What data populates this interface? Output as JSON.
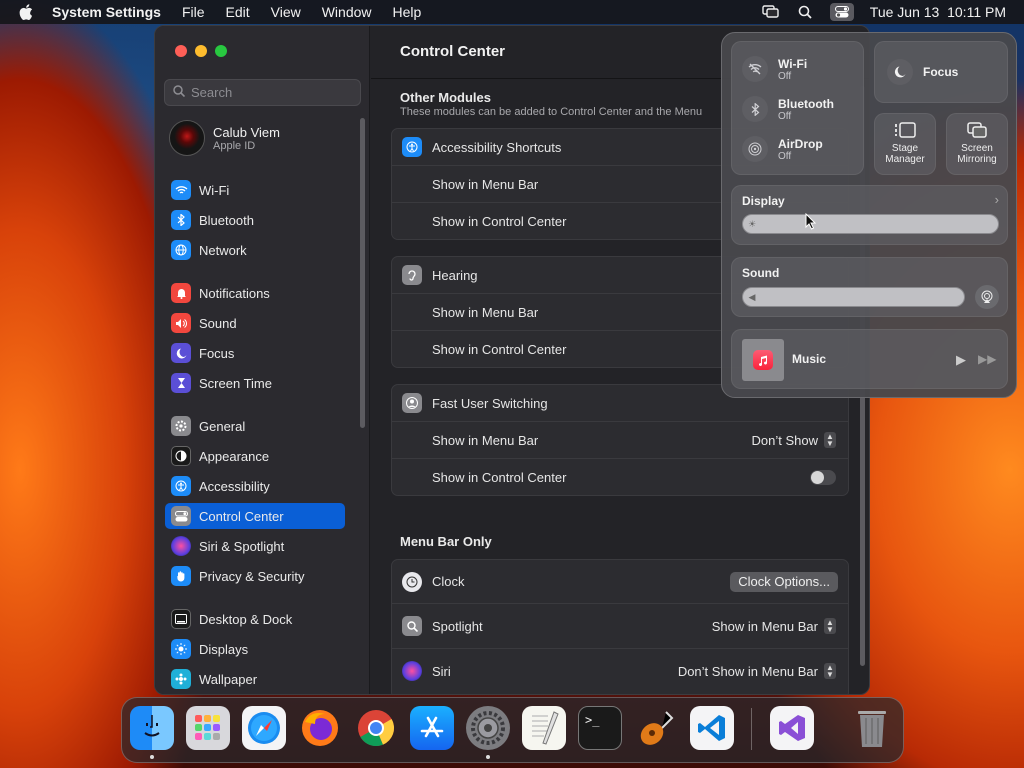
{
  "menubar": {
    "app_name": "System Settings",
    "items": [
      "File",
      "Edit",
      "View",
      "Window",
      "Help"
    ],
    "datetime": "Tue Jun 13  10:11 PM"
  },
  "window": {
    "search_placeholder": "Search",
    "profile": {
      "name": "Calub Viem",
      "subtitle": "Apple ID"
    },
    "sidebar": [
      {
        "label": "Wi-Fi",
        "icon": "wifi-icon",
        "color": "#1d8cf8"
      },
      {
        "label": "Bluetooth",
        "icon": "bluetooth-icon",
        "color": "#1d8cf8"
      },
      {
        "label": "Network",
        "icon": "globe-icon",
        "color": "#1d8cf8"
      },
      {
        "label": "Notifications",
        "icon": "bell-icon",
        "color": "#f2473e"
      },
      {
        "label": "Sound",
        "icon": "speaker-icon",
        "color": "#f2473e"
      },
      {
        "label": "Focus",
        "icon": "moon-icon",
        "color": "#5b4fd6"
      },
      {
        "label": "Screen Time",
        "icon": "hourglass-icon",
        "color": "#5b4fd6"
      },
      {
        "label": "General",
        "icon": "gear-icon",
        "color": "#8a8a8e"
      },
      {
        "label": "Appearance",
        "icon": "appearance-icon",
        "color": "#1a1a1a"
      },
      {
        "label": "Accessibility",
        "icon": "accessibility-icon",
        "color": "#1d8cf8"
      },
      {
        "label": "Control Center",
        "icon": "control-center-icon",
        "color": "#8a8a8e"
      },
      {
        "label": "Siri & Spotlight",
        "icon": "siri-icon",
        "color": "#9b3fd1"
      },
      {
        "label": "Privacy & Security",
        "icon": "hand-icon",
        "color": "#1d8cf8"
      },
      {
        "label": "Desktop & Dock",
        "icon": "dock-icon",
        "color": "#1a1a1a"
      },
      {
        "label": "Displays",
        "icon": "sun-icon",
        "color": "#1d8cf8"
      },
      {
        "label": "Wallpaper",
        "icon": "wallpaper-icon",
        "color": "#1fb0d8"
      }
    ],
    "selected_sidebar": "Control Center",
    "main": {
      "title": "Control Center",
      "other_modules_title": "Other Modules",
      "other_modules_sub": "These modules can be added to Control Center and the Menu",
      "accessibility": {
        "title": "Accessibility Shortcuts",
        "row1": "Show in Menu Bar",
        "row2": "Show in Control Center"
      },
      "hearing": {
        "title": "Hearing",
        "row1": "Show in Menu Bar",
        "row2": "Show in Control Center"
      },
      "fus": {
        "title": "Fast User Switching",
        "row1": "Show in Menu Bar",
        "row1_value": "Don’t Show",
        "row2": "Show in Control Center"
      },
      "menu_bar_only_title": "Menu Bar Only",
      "clock": {
        "title": "Clock",
        "button": "Clock Options..."
      },
      "spotlight": {
        "title": "Spotlight",
        "value": "Show in Menu Bar"
      },
      "siri": {
        "title": "Siri",
        "value": "Don’t Show in Menu Bar"
      }
    }
  },
  "control_center": {
    "wifi": {
      "title": "Wi-Fi",
      "status": "Off"
    },
    "bluetooth": {
      "title": "Bluetooth",
      "status": "Off"
    },
    "airdrop": {
      "title": "AirDrop",
      "status": "Off"
    },
    "focus": "Focus",
    "stage_manager": "Stage\nManager",
    "screen_mirroring": "Screen\nMirroring",
    "display": "Display",
    "sound": "Sound",
    "music": "Music"
  },
  "dock": {
    "apps": [
      "Finder",
      "Launchpad",
      "Safari",
      "Firefox",
      "Chrome",
      "App Store",
      "System Settings",
      "TextEdit",
      "Terminal",
      "GarageBand",
      "Visual Studio Code",
      "Visual Studio",
      "Trash"
    ]
  }
}
